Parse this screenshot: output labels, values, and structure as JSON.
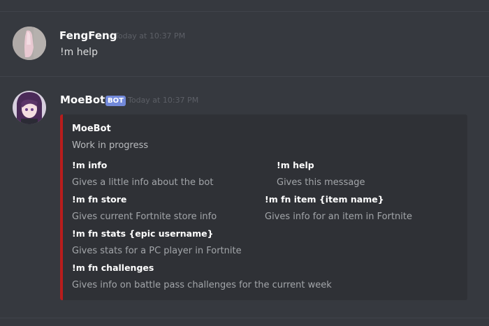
{
  "messages": [
    {
      "username": "FengFeng",
      "timestamp": "Today at 10:37 PM",
      "text": "!m help"
    },
    {
      "username": "MoeBot",
      "bot_tag": "BOT",
      "timestamp": "Today at 10:37 PM",
      "embed": {
        "accent_color": "#b91c1c",
        "author": "MoeBot",
        "description": "Work in progress",
        "fields": [
          {
            "name": "!m info",
            "value": "Gives a little info about the bot"
          },
          {
            "name": "!m help",
            "value": "Gives this message"
          },
          {
            "name": "!m fn store",
            "value": "Gives current Fortnite store info"
          },
          {
            "name": "!m fn item {item name}",
            "value": "Gives info for an item in Fortnite"
          },
          {
            "name": "!m fn stats {epic username}",
            "value": "Gives stats for a PC player in Fortnite"
          },
          {
            "name": "!m fn challenges",
            "value": "Gives info on battle pass challenges for the current week"
          }
        ]
      }
    }
  ],
  "colors": {
    "background": "#36393f",
    "embed_background": "#2f3136",
    "bot_tag": "#7289da"
  }
}
